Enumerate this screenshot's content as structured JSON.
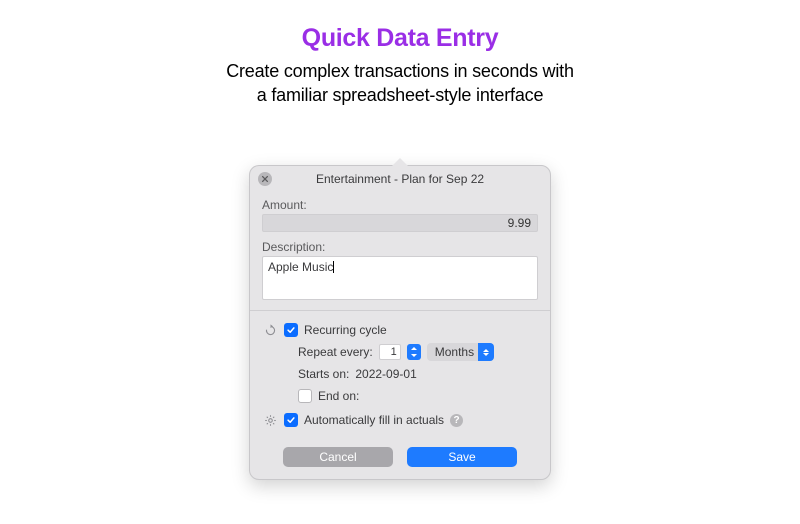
{
  "marketing": {
    "headline": "Quick Data Entry",
    "subhead_line1": "Create complex transactions in seconds with",
    "subhead_line2": "a familiar spreadsheet-style interface"
  },
  "popover": {
    "title": "Entertainment - Plan for Sep 22",
    "amount_label": "Amount:",
    "amount_value": "9.99",
    "description_label": "Description:",
    "description_value": "Apple Music",
    "recurring": {
      "label": "Recurring cycle",
      "checked": true,
      "repeat_label": "Repeat every:",
      "repeat_count": "1",
      "repeat_unit": "Months",
      "starts_label": "Starts on:",
      "starts_value": "2022-09-01",
      "end_label": "End on:",
      "end_checked": false
    },
    "autofill": {
      "label": "Automatically fill in actuals",
      "checked": true
    },
    "buttons": {
      "cancel": "Cancel",
      "save": "Save"
    }
  }
}
